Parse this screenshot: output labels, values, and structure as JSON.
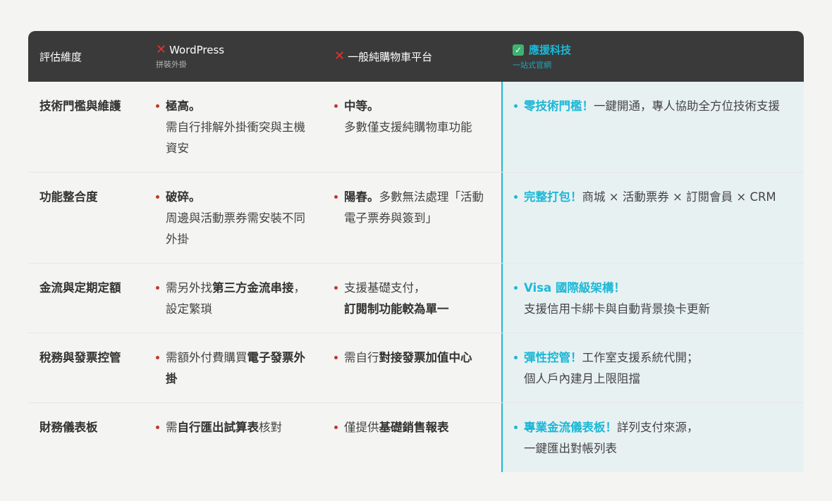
{
  "header": {
    "col0": "評估維度",
    "col1": {
      "title": "WordPress",
      "sub": "拼裝外掛"
    },
    "col2": {
      "title": "一般純購物車平台"
    },
    "col3": {
      "title": "應援科技",
      "sub": "一站式官網"
    }
  },
  "rows": [
    {
      "label": "技術門檻與維護",
      "c1": {
        "bold": "極高。",
        "text": "需自行排解外掛衝突與主機資安"
      },
      "c2": {
        "bold": "中等。",
        "text": "多數僅支援純購物車功能"
      },
      "c3": {
        "accent": "零技術門檻！",
        "text": "一鍵開通，專人協助全方位技術支援"
      }
    },
    {
      "label": "功能整合度",
      "c1": {
        "bold": "破碎。",
        "text": "周邊與活動票券需安裝不同外掛"
      },
      "c2": {
        "bold": "陽春。",
        "text": "多數無法處理「活動電子票券與簽到」"
      },
      "c3": {
        "accent": "完整打包！",
        "text": "商城 × 活動票券 × 訂閱會員 × CRM"
      }
    },
    {
      "label": "金流與定期定額",
      "c1": {
        "pre": "需另外找",
        "bold": "第三方金流串接",
        "post": "，設定繁瑣"
      },
      "c2": {
        "pre": "支援基礎支付，",
        "bold": "訂閱制功能較為單一"
      },
      "c3": {
        "accent": "Visa 國際級架構！",
        "text": "支援信用卡綁卡與自動背景換卡更新"
      }
    },
    {
      "label": "稅務與發票控管",
      "c1": {
        "pre": "需額外付費購買",
        "bold": "電子發票外掛"
      },
      "c2": {
        "pre": "需自行",
        "bold": "對接發票加值中心"
      },
      "c3": {
        "accent": "彈性控管！",
        "text": "工作室支援系統代開；",
        "text2": "個人戶內建月上限阻擋"
      }
    },
    {
      "label": "財務儀表板",
      "c1": {
        "pre": "需",
        "bold": "自行匯出試算表",
        "post": "核對"
      },
      "c2": {
        "pre": "僅提供",
        "bold": "基礎銷售報表"
      },
      "c3": {
        "accent": "專業金流儀表板！",
        "text": "詳列支付來源，",
        "text2": "一鍵匯出對帳列表"
      }
    }
  ],
  "colors": {
    "accent": "#1cb8d6",
    "bullet": "#c0392b",
    "header_bg": "#3a3a3a",
    "highlight_bg": "#e8f1f2"
  }
}
